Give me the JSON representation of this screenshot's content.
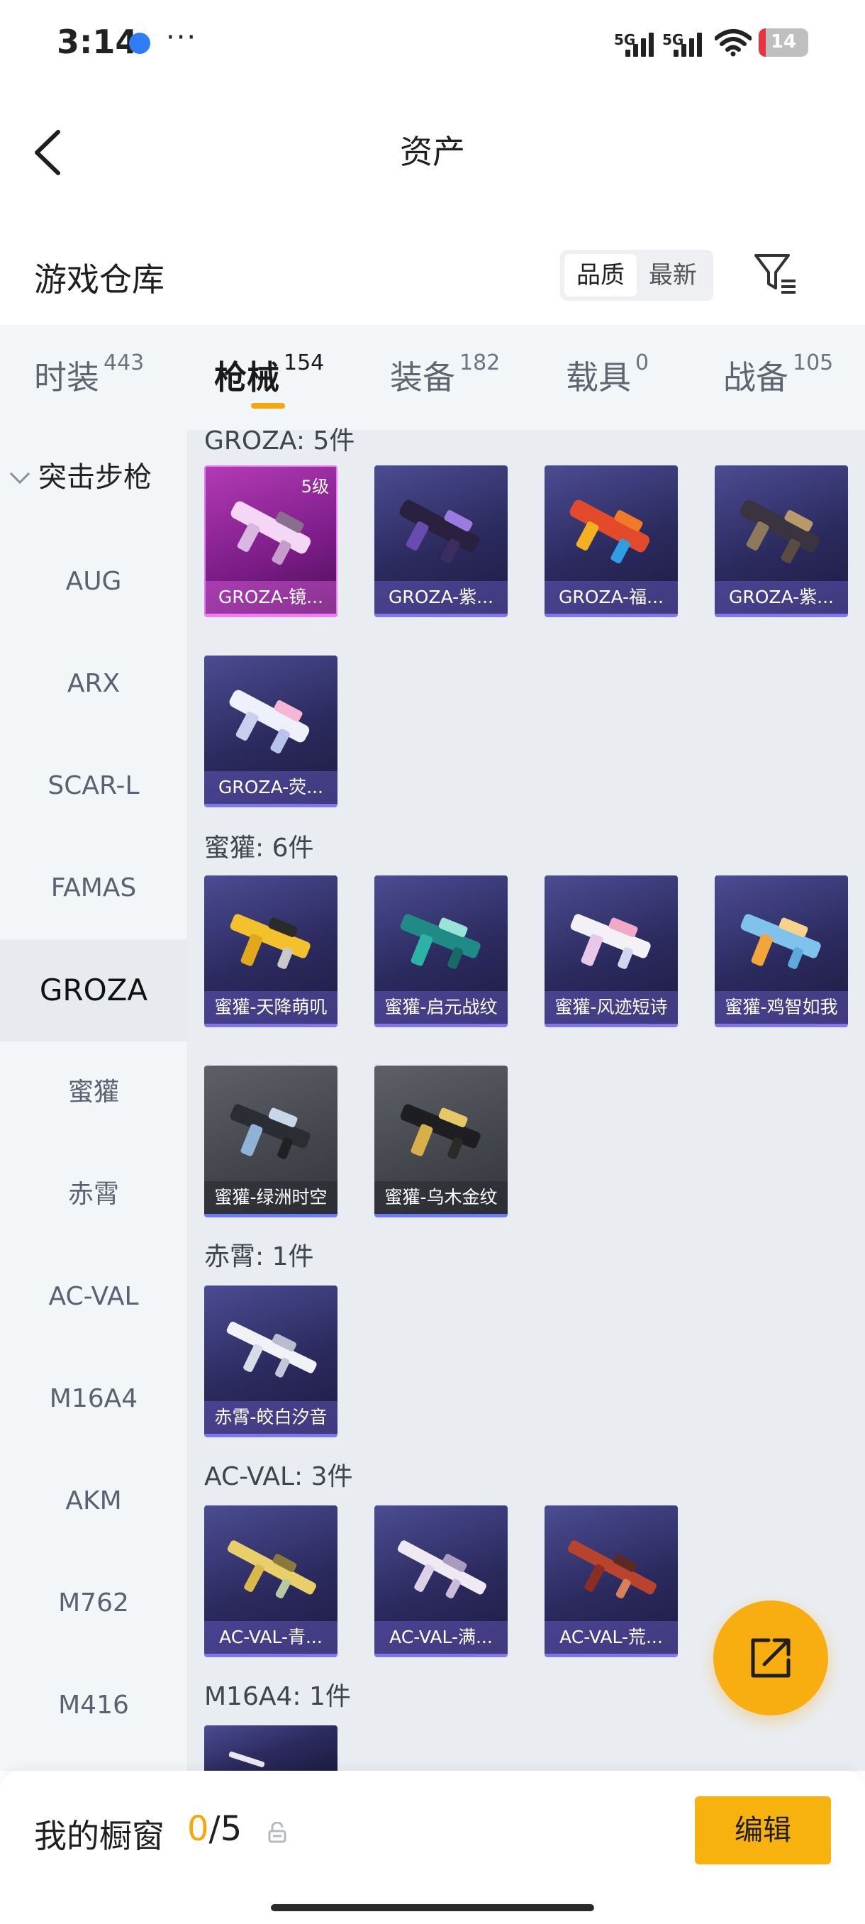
{
  "status_bar": {
    "time": "3:14",
    "more": "···",
    "signal1": "5G",
    "signal2": "5G",
    "battery": "14",
    "battery_level": 0.14
  },
  "header": {
    "title": "资产"
  },
  "section": {
    "title": "游戏仓库",
    "sort_options": [
      "品质",
      "最新"
    ],
    "active_sort": "品质"
  },
  "tabs": [
    {
      "label": "时装",
      "count": "443"
    },
    {
      "label": "枪械",
      "count": "154"
    },
    {
      "label": "装备",
      "count": "182"
    },
    {
      "label": "载具",
      "count": "0"
    },
    {
      "label": "战备",
      "count": "105"
    }
  ],
  "active_tab": "枪械",
  "sidebar": {
    "header": "突击步枪",
    "items": [
      "AUG",
      "ARX",
      "SCAR-L",
      "FAMAS",
      "GROZA",
      "蜜獾",
      "赤霄",
      "AC-VAL",
      "M16A4",
      "AKM",
      "M762",
      "M416"
    ],
    "selected": "GROZA"
  },
  "groups": [
    {
      "title": "GROZA: 5件"
    },
    {
      "title": "蜜獾: 6件"
    },
    {
      "title": "赤霄: 1件"
    },
    {
      "title": "AC-VAL: 3件"
    },
    {
      "title": "M16A4: 1件"
    }
  ],
  "cards": {
    "groza": [
      {
        "name": "GROZA-镜...",
        "level": "5级"
      },
      {
        "name": "GROZA-紫..."
      },
      {
        "name": "GROZA-福..."
      },
      {
        "name": "GROZA-紫..."
      },
      {
        "name": "GROZA-荧..."
      }
    ],
    "mihuan": [
      {
        "name": "蜜獾-天降萌叽"
      },
      {
        "name": "蜜獾-启元战纹"
      },
      {
        "name": "蜜獾-风迹短诗"
      },
      {
        "name": "蜜獾-鸡智如我"
      },
      {
        "name": "蜜獾-绿洲时空"
      },
      {
        "name": "蜜獾-乌木金纹"
      }
    ],
    "chixiao": [
      {
        "name": "赤霄-皎白汐音"
      }
    ],
    "acval": [
      {
        "name": "AC-VAL-青..."
      },
      {
        "name": "AC-VAL-满..."
      },
      {
        "name": "AC-VAL-荒..."
      }
    ]
  },
  "bottom_bar": {
    "label": "我的橱窗",
    "used": "0",
    "total": "/5",
    "edit_label": "编辑"
  },
  "colors": {
    "accent": "#f5a70c",
    "fab": "#f8ad11",
    "card_purple": "#2b2a5e",
    "card_pink": "#b33ab5",
    "card_grey": "#4b4d54"
  }
}
